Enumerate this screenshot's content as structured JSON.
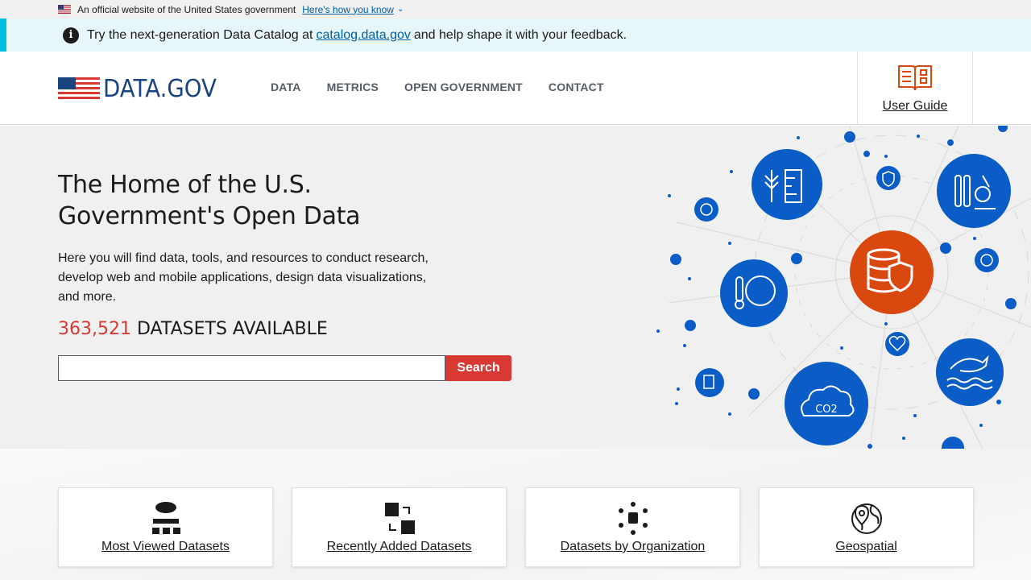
{
  "gov_banner": {
    "text": "An official website of the United States government",
    "link": "Here's how you know"
  },
  "alert": {
    "before": "Try the next-generation Data Catalog at",
    "link": "catalog.data.gov",
    "after": "and help shape it with your feedback."
  },
  "header": {
    "logo": "DATA.GOV",
    "nav": [
      "DATA",
      "METRICS",
      "OPEN GOVERNMENT",
      "CONTACT"
    ],
    "user_guide": "User Guide"
  },
  "hero": {
    "title": "The Home of the U.S. Government's Open Data",
    "description": "Here you will find data, tools, and resources to conduct research, develop web and mobile applications, design data visualizations, and more.",
    "dataset_count": "363,521",
    "dataset_suffix": "DATASETS AVAILABLE",
    "search_value": "",
    "search_button": "Search"
  },
  "cards": [
    {
      "label": "Most Viewed Datasets",
      "icon": "hierarchy-icon"
    },
    {
      "label": "Recently Added Datasets",
      "icon": "swap-squares-icon"
    },
    {
      "label": "Datasets by Organization",
      "icon": "organization-dots-icon"
    },
    {
      "label": "Geospatial",
      "icon": "globe-pin-icon"
    }
  ],
  "colors": {
    "accent_red": "#d83933",
    "brand_blue": "#1a4480",
    "link_blue": "#005ea2",
    "illustration_blue": "#0a5cc7",
    "illustration_orange": "#d9480f"
  }
}
